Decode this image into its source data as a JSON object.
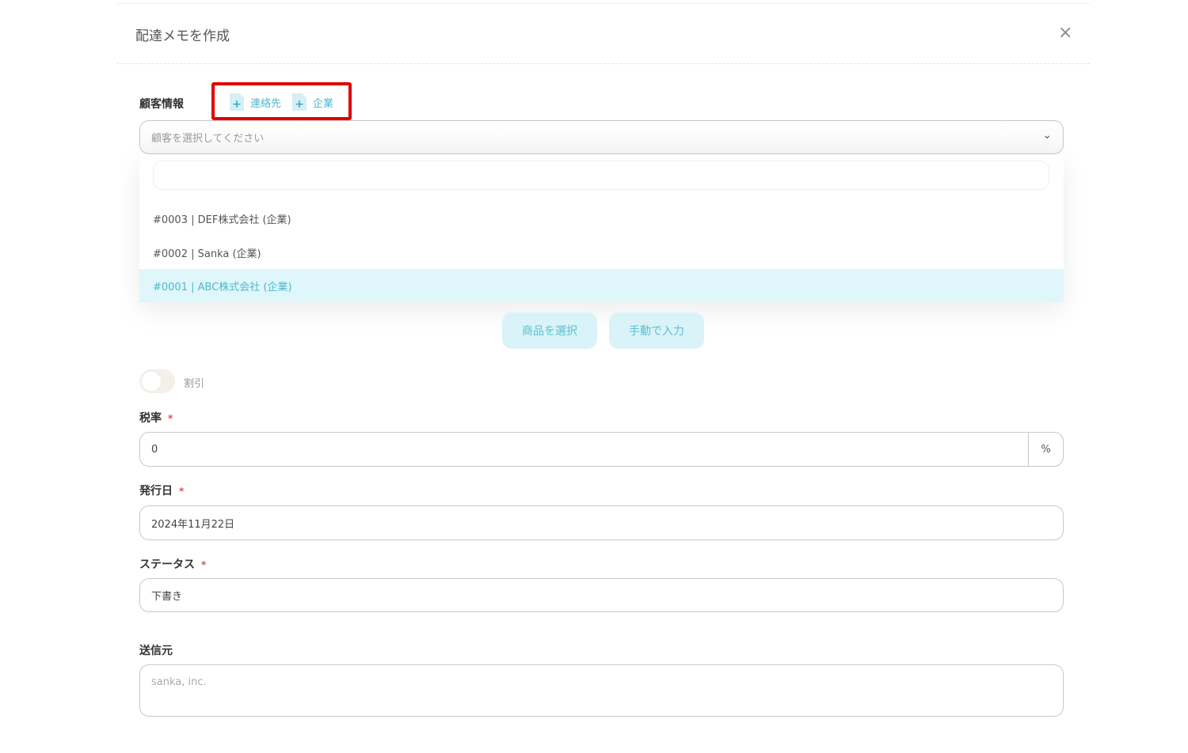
{
  "modal": {
    "title": "配達メモを作成",
    "close": "×"
  },
  "customer": {
    "label": "顧客情報",
    "add_contact": "連絡先",
    "add_company": "企業",
    "plus": "+",
    "placeholder": "顧客を選択してください",
    "chevron": "⌄",
    "options": [
      {
        "label": "#0003 | DEF株式会社 (企業)",
        "selected": false
      },
      {
        "label": "#0002 | Sanka (企業)",
        "selected": false
      },
      {
        "label": "#0001 | ABC株式会社 (企業)",
        "selected": true
      }
    ]
  },
  "buttons": {
    "select_product": "商品を選択",
    "manual_input": "手動で入力"
  },
  "discount": {
    "label": "割引",
    "on": false
  },
  "tax": {
    "label": "税率",
    "required": "*",
    "value": "0",
    "unit": "%"
  },
  "issue_date": {
    "label": "発行日",
    "required": "*",
    "value": "2024年11月22日"
  },
  "status": {
    "label": "ステータス",
    "required": "*",
    "value": "下書き"
  },
  "sender": {
    "label": "送信元",
    "placeholder": "sanka, inc."
  }
}
